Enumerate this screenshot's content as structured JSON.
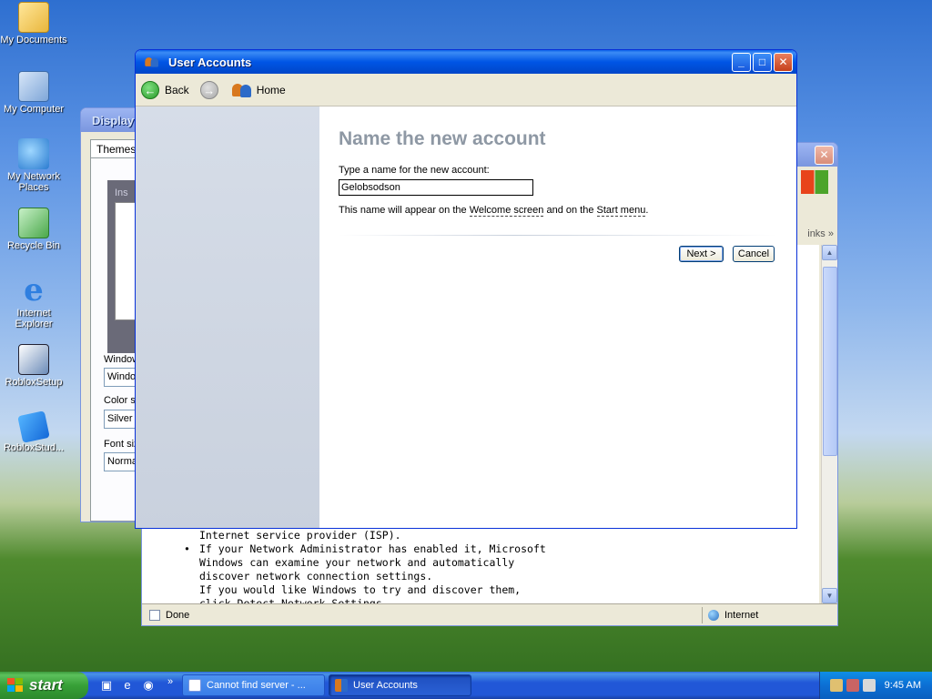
{
  "desktop": {
    "icons": [
      {
        "label": "My Documents",
        "icon": "my-documents-icon"
      },
      {
        "label": "My Computer",
        "icon": "my-computer-icon"
      },
      {
        "label": "My Network Places",
        "icon": "network-places-icon"
      },
      {
        "label": "Recycle Bin",
        "icon": "recycle-bin-icon"
      },
      {
        "label": "Internet Explorer",
        "icon": "internet-explorer-icon"
      },
      {
        "label": "RobloxSetup",
        "icon": "roblox-setup-icon"
      },
      {
        "label": "RobloxStud...",
        "icon": "roblox-studio-icon"
      }
    ]
  },
  "display_properties": {
    "title": "Display P",
    "tab": "Themes",
    "preview_label": "Ins",
    "windows_label": "Window",
    "windows_value": "Windo",
    "color_label": "Color sc",
    "color_value": "Silver",
    "font_label": "Font siz",
    "font_value": "Norma"
  },
  "ie_window": {
    "content_lines": [
      "Internet service provider (ISP).",
      "If your Network Administrator has enabled it, Microsoft",
      "Windows can examine your network and automatically",
      "discover network connection settings.",
      "If you would like Windows to try and discover them,",
      "click  Detect Network Settings"
    ],
    "links_label": "inks",
    "status_left": "Done",
    "status_zone": "Internet"
  },
  "user_accounts": {
    "title": "User Accounts",
    "toolbar": {
      "back": "Back",
      "home": "Home"
    },
    "heading": "Name the new account",
    "prompt": "Type a name for the new account:",
    "name_value": "Gelobsodson",
    "info_prefix": "This name will appear on the ",
    "info_link1": "Welcome screen",
    "info_mid": " and on the ",
    "info_link2": "Start menu",
    "info_suffix": ".",
    "next_button": "Next >",
    "cancel_button": "Cancel"
  },
  "taskbar": {
    "start_label": "start",
    "tasks": [
      {
        "label": "Cannot find server - ...",
        "active": false
      },
      {
        "label": "User Accounts",
        "active": true
      }
    ],
    "clock": "9:45 AM"
  },
  "colors": {
    "titlebar_active": "#0055e5",
    "heading_gray": "#8e98a4",
    "start_green": "#37a037"
  }
}
